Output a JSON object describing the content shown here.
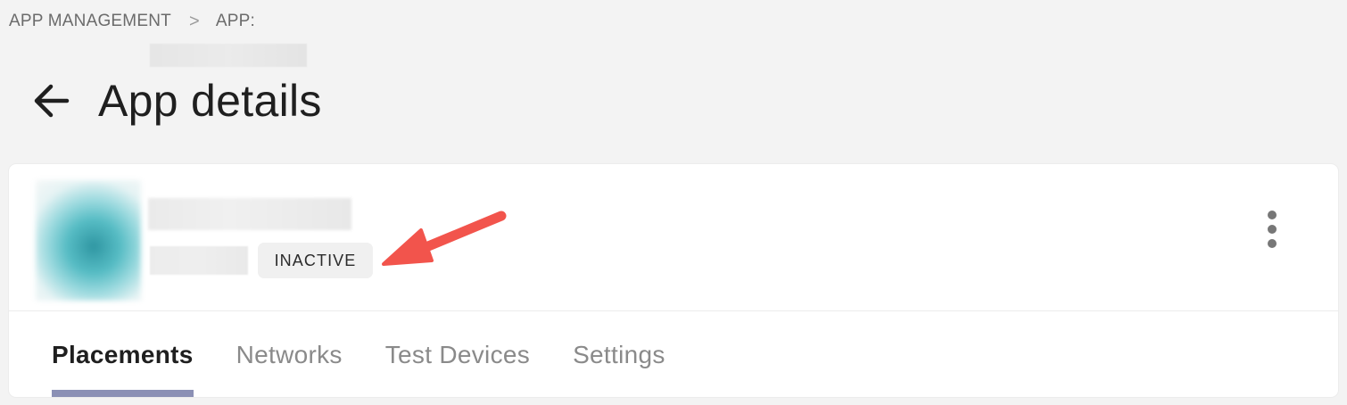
{
  "breadcrumb": {
    "root": "APP MANAGEMENT",
    "separator": ">",
    "current_prefix": "APP:"
  },
  "header": {
    "title": "App details",
    "back_icon": "arrow-left-icon"
  },
  "app_card": {
    "status_badge": "INACTIVE",
    "more_icon": "more-vertical-icon",
    "annotation_color": "#f2544c"
  },
  "tabs": [
    {
      "label": "Placements",
      "active": true
    },
    {
      "label": "Networks",
      "active": false
    },
    {
      "label": "Test Devices",
      "active": false
    },
    {
      "label": "Settings",
      "active": false
    }
  ],
  "colors": {
    "background": "#f3f3f3",
    "card": "#ffffff",
    "active_tab_indicator": "#8b90b5",
    "badge_bg": "#f0f0f0"
  }
}
